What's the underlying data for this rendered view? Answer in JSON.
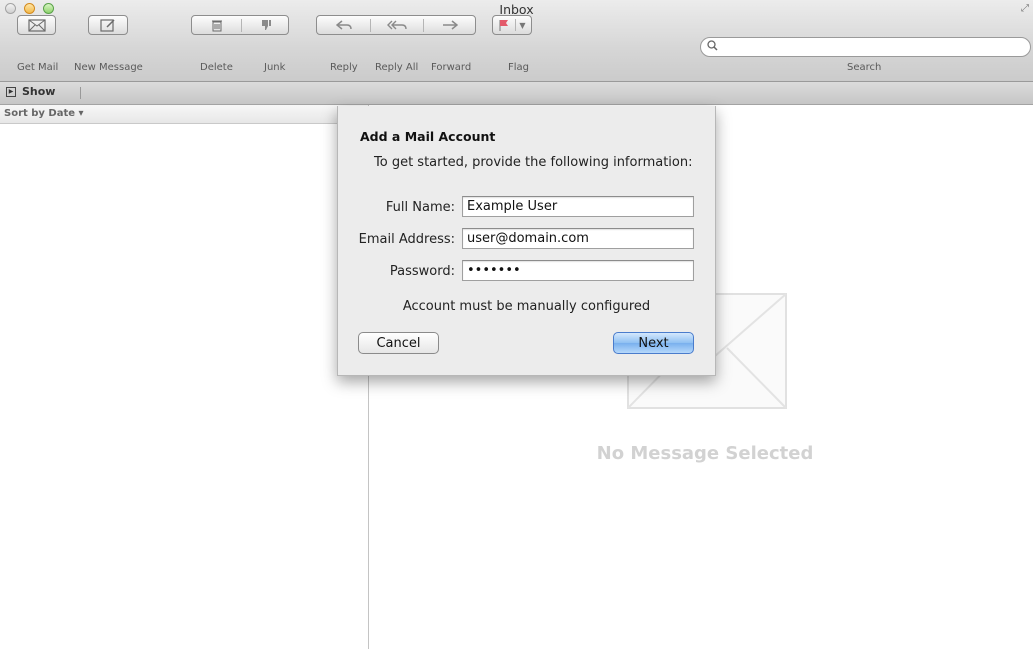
{
  "window": {
    "title": "Inbox"
  },
  "toolbar": {
    "get_mail": "Get Mail",
    "new_message": "New Message",
    "delete": "Delete",
    "junk": "Junk",
    "reply": "Reply",
    "reply_all": "Reply All",
    "forward": "Forward",
    "flag": "Flag",
    "search_label": "Search",
    "search_value": ""
  },
  "showbar": {
    "show_label": "Show"
  },
  "message_list": {
    "sort_label": "Sort by Date ▾"
  },
  "viewer": {
    "empty_text": "No Message Selected"
  },
  "dialog": {
    "title": "Add a Mail Account",
    "subtitle": "To get started, provide the following information:",
    "full_name_label": "Full Name:",
    "full_name_value": "Example User",
    "email_label": "Email Address:",
    "email_value": "user@domain.com",
    "password_label": "Password:",
    "password_value": "•••••••",
    "note": "Account must be manually configured",
    "cancel_label": "Cancel",
    "next_label": "Next"
  }
}
